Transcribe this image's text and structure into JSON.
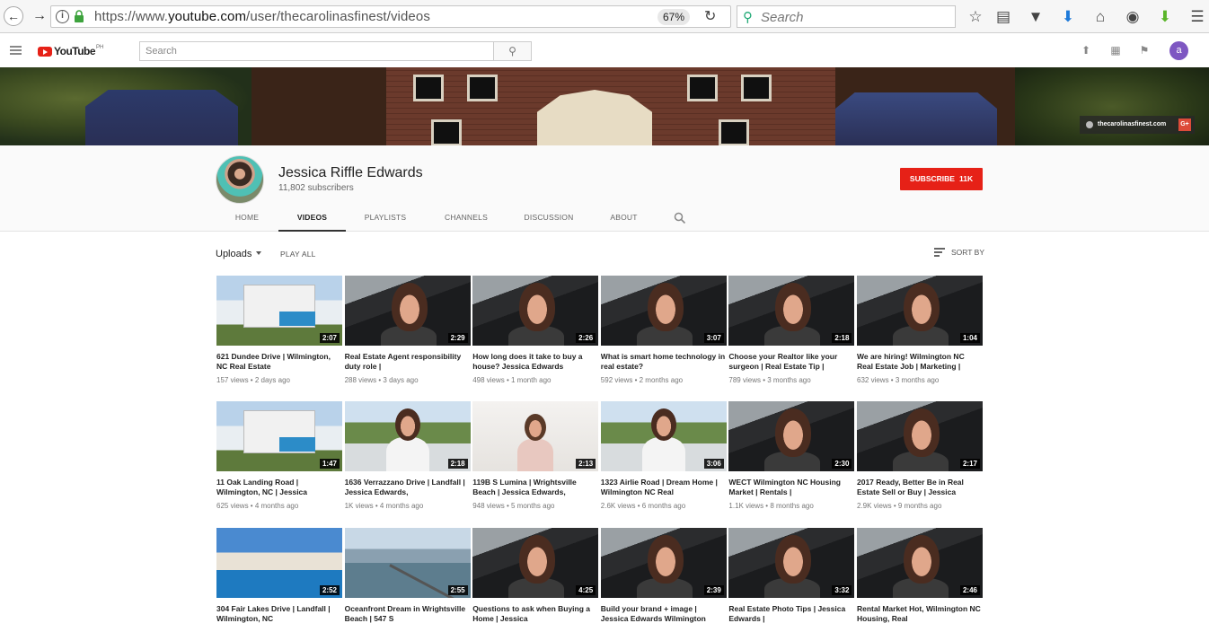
{
  "browser": {
    "url_prefix": "https://www.",
    "url_domain": "youtube.com",
    "url_path": "/user/thecarolinasfinest/videos",
    "zoom": "67%",
    "search_placeholder": "Search",
    "icons": [
      "back-icon",
      "forward-icon",
      "info-icon",
      "lock-icon",
      "reload-icon",
      "bookmark-star-icon",
      "reading-list-icon",
      "pocket-icon",
      "download-icon",
      "home-icon",
      "globe-icon",
      "addon-download-icon",
      "menu-icon"
    ]
  },
  "yt": {
    "logo_text": "YouTube",
    "logo_country": "PH",
    "search_placeholder": "Search",
    "user_initial": "a"
  },
  "banner": {
    "link_text": "thecarolinasfinest.com",
    "gplus": "G+"
  },
  "channel": {
    "name": "Jessica Riffle Edwards",
    "subscribers": "11,802 subscribers",
    "subscribe_label": "SUBSCRIBE",
    "subscribe_count": "11K",
    "tabs": [
      "HOME",
      "VIDEOS",
      "PLAYLISTS",
      "CHANNELS",
      "DISCUSSION",
      "ABOUT"
    ],
    "active_tab": "VIDEOS"
  },
  "controls": {
    "uploads_label": "Uploads",
    "play_all_label": "PLAY ALL",
    "sort_label": "SORT BY"
  },
  "videos": [
    {
      "title": "621 Dundee Drive | Wilmington, NC Real Estate",
      "meta": "157 views • 2 days ago",
      "duration": "2:07",
      "thumb": "house"
    },
    {
      "title": "Real Estate Agent responsibility duty role |",
      "meta": "288 views • 3 days ago",
      "duration": "2:29",
      "thumb": "car"
    },
    {
      "title": "How long does it take to buy a house? Jessica Edwards",
      "meta": "498 views • 1 month ago",
      "duration": "2:26",
      "thumb": "car"
    },
    {
      "title": "What is smart home technology in real estate?",
      "meta": "592 views • 2 months ago",
      "duration": "3:07",
      "thumb": "car"
    },
    {
      "title": "Choose your Realtor like your surgeon | Real Estate Tip |",
      "meta": "789 views • 3 months ago",
      "duration": "2:18",
      "thumb": "car"
    },
    {
      "title": "We are hiring! Wilmington NC Real Estate Job | Marketing |",
      "meta": "632 views • 3 months ago",
      "duration": "1:04",
      "thumb": "car"
    },
    {
      "title": "11 Oak Landing Road | Wilmington, NC | Jessica",
      "meta": "625 views • 4 months ago",
      "duration": "1:47",
      "thumb": "house"
    },
    {
      "title": "1636 Verrazzano Drive | Landfall | Jessica Edwards,",
      "meta": "1K views • 4 months ago",
      "duration": "2:18",
      "thumb": "outdoor"
    },
    {
      "title": "119B S Lumina | Wrightsville Beach | Jessica Edwards,",
      "meta": "948 views • 5 months ago",
      "duration": "2:13",
      "thumb": "studio"
    },
    {
      "title": "1323 Airlie Road | Dream Home | Wilmington NC Real",
      "meta": "2.6K views • 6 months ago",
      "duration": "3:06",
      "thumb": "outdoor"
    },
    {
      "title": "WECT Wilmington NC Housing Market | Rentals |",
      "meta": "1.1K views • 8 months ago",
      "duration": "2:30",
      "thumb": "car"
    },
    {
      "title": "2017 Ready, Better Be in Real Estate Sell or Buy | Jessica",
      "meta": "2.9K views • 9 months ago",
      "duration": "2:17",
      "thumb": "car"
    },
    {
      "title": "304 Fair Lakes Drive | Landfall | Wilmington, NC",
      "meta": "",
      "duration": "2:52",
      "thumb": "pool"
    },
    {
      "title": "Oceanfront Dream in Wrightsville Beach | 547 S",
      "meta": "",
      "duration": "2:55",
      "thumb": "coast"
    },
    {
      "title": "Questions to ask when Buying a Home | Jessica",
      "meta": "",
      "duration": "4:25",
      "thumb": "car"
    },
    {
      "title": "Build your brand + image | Jessica Edwards Wilmington",
      "meta": "",
      "duration": "2:39",
      "thumb": "car"
    },
    {
      "title": "Real Estate Photo Tips | Jessica Edwards |",
      "meta": "",
      "duration": "3:32",
      "thumb": "car"
    },
    {
      "title": "Rental Market Hot, Wilmington NC Housing, Real",
      "meta": "",
      "duration": "2:46",
      "thumb": "car"
    }
  ]
}
